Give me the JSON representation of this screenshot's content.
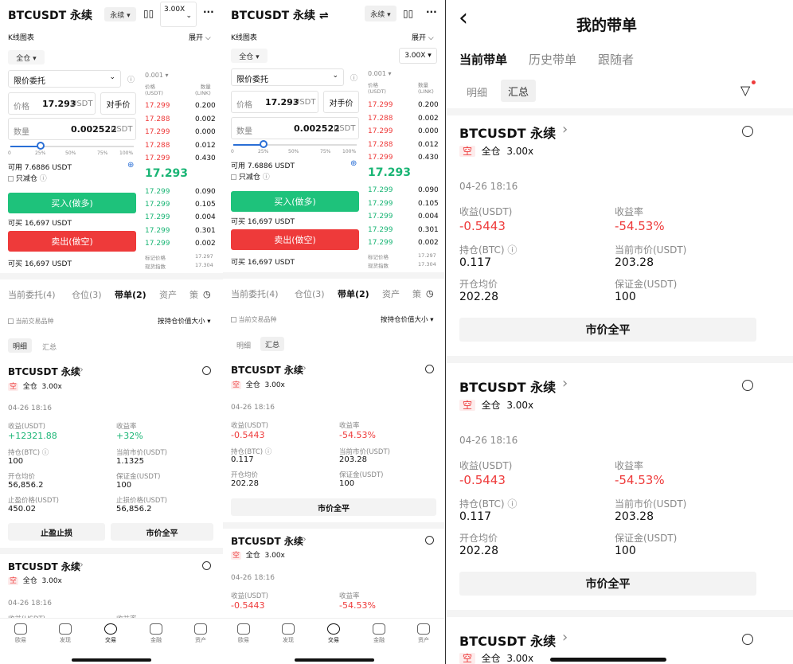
{
  "s1": {
    "title": "BTCUSDT 永续",
    "perp": "永续 ▾",
    "leverage": "3.00X",
    "more": "···",
    "kline": "K线图表",
    "expand": "展开 ⌵",
    "margin_mode": "全仓 ▾",
    "order_type": "限价委托",
    "price_label": "价格",
    "price_value": "17.293",
    "unit": "USDT",
    "counter_price": "对手价",
    "qty_label": "数量",
    "qty_value": "0.002522",
    "pcts": [
      "0",
      "25%",
      "50%",
      "75%",
      "100%"
    ],
    "avail": "可用 7.6886 USDT",
    "reduce_only": "只减仓",
    "buy": "买入(做多)",
    "buy_max": "可买 16,697 USDT",
    "sell": "卖出(做空)",
    "sell_max": "可买 16,697 USDT",
    "ob_step": "0.001 ▾",
    "ob_price_h": "价格\n(USDT)",
    "ob_qty_h": "数量\n(LINK)",
    "asks": [
      [
        "17.299",
        "0.200"
      ],
      [
        "17.288",
        "0.002"
      ],
      [
        "17.299",
        "0.000"
      ],
      [
        "17.288",
        "0.012"
      ],
      [
        "17.299",
        "0.430"
      ]
    ],
    "mid": "17.293",
    "bids": [
      [
        "17.299",
        "0.090"
      ],
      [
        "17.299",
        "0.105"
      ],
      [
        "17.299",
        "0.004"
      ],
      [
        "17.299",
        "0.301"
      ],
      [
        "17.299",
        "0.002"
      ]
    ],
    "mark_label": "标记价格",
    "mark": "17.297",
    "index_label": "现货指数",
    "index": "17.304",
    "tabs": [
      "当前委托(4)",
      "仓位(3)",
      "带单(2)",
      "资产",
      "策"
    ],
    "cur_symbol": "当前交易品种",
    "sort": "按持仓价值大小 ▾",
    "sub_tabs": [
      "明细",
      "汇总"
    ],
    "card": {
      "symbol": "BTCUSDT 永续",
      "side": "空",
      "mode": "全仓",
      "lev": "3.00x",
      "time": "04-26 18:16",
      "pnl_l": "收益(USDT)",
      "pnl": "+12321.88",
      "roe_l": "收益率",
      "roe": "+32%",
      "pos_l": "持仓(BTC) ⓘ",
      "pos": "100",
      "mkt_l": "当前市价(USDT)",
      "mkt": "1.1325",
      "open_l": "开仓均价",
      "open": "56,856.2",
      "mg_l": "保证金(USDT)",
      "mg": "100",
      "tp_l": "止盈价格(USDT)",
      "tp": "450.02",
      "sl_l": "止损价格(USDT)",
      "sl": "56,856.2",
      "btn1": "止盈止损",
      "btn2": "市价全平"
    },
    "card2": {
      "symbol": "BTCUSDT 永续",
      "side": "空",
      "mode": "全仓",
      "lev": "3.00x",
      "time": "04-26 18:16",
      "l1": "收益(USDT)",
      "l2": "收益率"
    },
    "nav": [
      "欧易",
      "发现",
      "交易",
      "金融",
      "资产"
    ]
  },
  "s2": {
    "title": "BTCUSDT 永续 ⇌",
    "perp": "永续 ▾",
    "more": "···",
    "kline": "K线图表",
    "expand": "展开 ⌵",
    "margin_mode": "全仓 ▾",
    "leverage": "3.00X ▾",
    "order_type": "限价委托",
    "price_label": "价格",
    "price_value": "17.293",
    "unit": "USDT",
    "counter_price": "对手价",
    "qty_label": "数量",
    "qty_value": "0.002522",
    "pcts": [
      "0",
      "25%",
      "50%",
      "75%",
      "100%"
    ],
    "avail": "可用 7.6886 USDT",
    "reduce_only": "只减仓",
    "buy": "买入(做多)",
    "buy_max": "可买 16,697 USDT",
    "sell": "卖出(做空)",
    "sell_max": "可买 16,697 USDT",
    "ob_step": "0.001 ▾",
    "ob_price_h": "价格\n(USDT)",
    "ob_qty_h": "数量\n(LINK)",
    "asks": [
      [
        "17.299",
        "0.200"
      ],
      [
        "17.288",
        "0.002"
      ],
      [
        "17.299",
        "0.000"
      ],
      [
        "17.288",
        "0.012"
      ],
      [
        "17.299",
        "0.430"
      ]
    ],
    "mid": "17.293",
    "bids": [
      [
        "17.299",
        "0.090"
      ],
      [
        "17.299",
        "0.105"
      ],
      [
        "17.299",
        "0.004"
      ],
      [
        "17.299",
        "0.301"
      ],
      [
        "17.299",
        "0.002"
      ]
    ],
    "mark_label": "标记价格",
    "mark": "17.297",
    "index_label": "现货指数",
    "index": "17.304",
    "tabs": [
      "当前委托(4)",
      "仓位(3)",
      "带单(2)",
      "资产",
      "策"
    ],
    "cur_symbol": "当前交易品种",
    "sort": "按持仓价值大小 ▾",
    "sub_tabs": [
      "明细",
      "汇总"
    ],
    "card": {
      "symbol": "BTCUSDT 永续",
      "side": "空",
      "mode": "全仓",
      "lev": "3.00x",
      "time": "04-26 18:16",
      "pnl_l": "收益(USDT)",
      "pnl": "-0.5443",
      "roe_l": "收益率",
      "roe": "-54.53%",
      "pos_l": "持仓(BTC) ⓘ",
      "pos": "0.117",
      "mkt_l": "当前市价(USDT)",
      "mkt": "203.28",
      "open_l": "开仓均价",
      "open": "202.28",
      "mg_l": "保证金(USDT)",
      "mg": "100",
      "btn": "市价全平"
    },
    "card2": {
      "symbol": "BTCUSDT 永续",
      "side": "空",
      "mode": "全仓",
      "lev": "3.00x",
      "time": "04-26 18:16",
      "l1": "收益(USDT)",
      "v1": "-0.5443",
      "l2": "收益率",
      "v2": "-54.53%"
    },
    "nav": [
      "欧易",
      "发现",
      "交易",
      "金融",
      "资产"
    ]
  },
  "s3": {
    "back": "‹",
    "title": "我的带单",
    "tabs": [
      "当前带单",
      "历史带单",
      "跟随者"
    ],
    "sub_tabs": [
      "明细",
      "汇总"
    ],
    "cards": [
      {
        "symbol": "BTCUSDT 永续",
        "side": "空",
        "mode": "全仓",
        "lev": "3.00x",
        "time": "04-26 18:16",
        "pnl_l": "收益(USDT)",
        "pnl": "-0.5443",
        "roe_l": "收益率",
        "roe": "-54.53%",
        "pos_l": "持仓(BTC) ⓘ",
        "pos": "0.117",
        "mkt_l": "当前市价(USDT)",
        "mkt": "203.28",
        "open_l": "开仓均价",
        "open": "202.28",
        "mg_l": "保证金(USDT)",
        "mg": "100",
        "btn": "市价全平"
      },
      {
        "symbol": "BTCUSDT 永续",
        "side": "空",
        "mode": "全仓",
        "lev": "3.00x",
        "time": "04-26 18:16",
        "pnl_l": "收益(USDT)",
        "pnl": "-0.5443",
        "roe_l": "收益率",
        "roe": "-54.53%",
        "pos_l": "持仓(BTC) ⓘ",
        "pos": "0.117",
        "mkt_l": "当前市价(USDT)",
        "mkt": "203.28",
        "open_l": "开仓均价",
        "open": "202.28",
        "mg_l": "保证金(USDT)",
        "mg": "100",
        "btn": "市价全平"
      },
      {
        "symbol": "BTCUSDT 永续",
        "side": "空",
        "mode": "全仓",
        "lev": "3.00x"
      }
    ]
  }
}
